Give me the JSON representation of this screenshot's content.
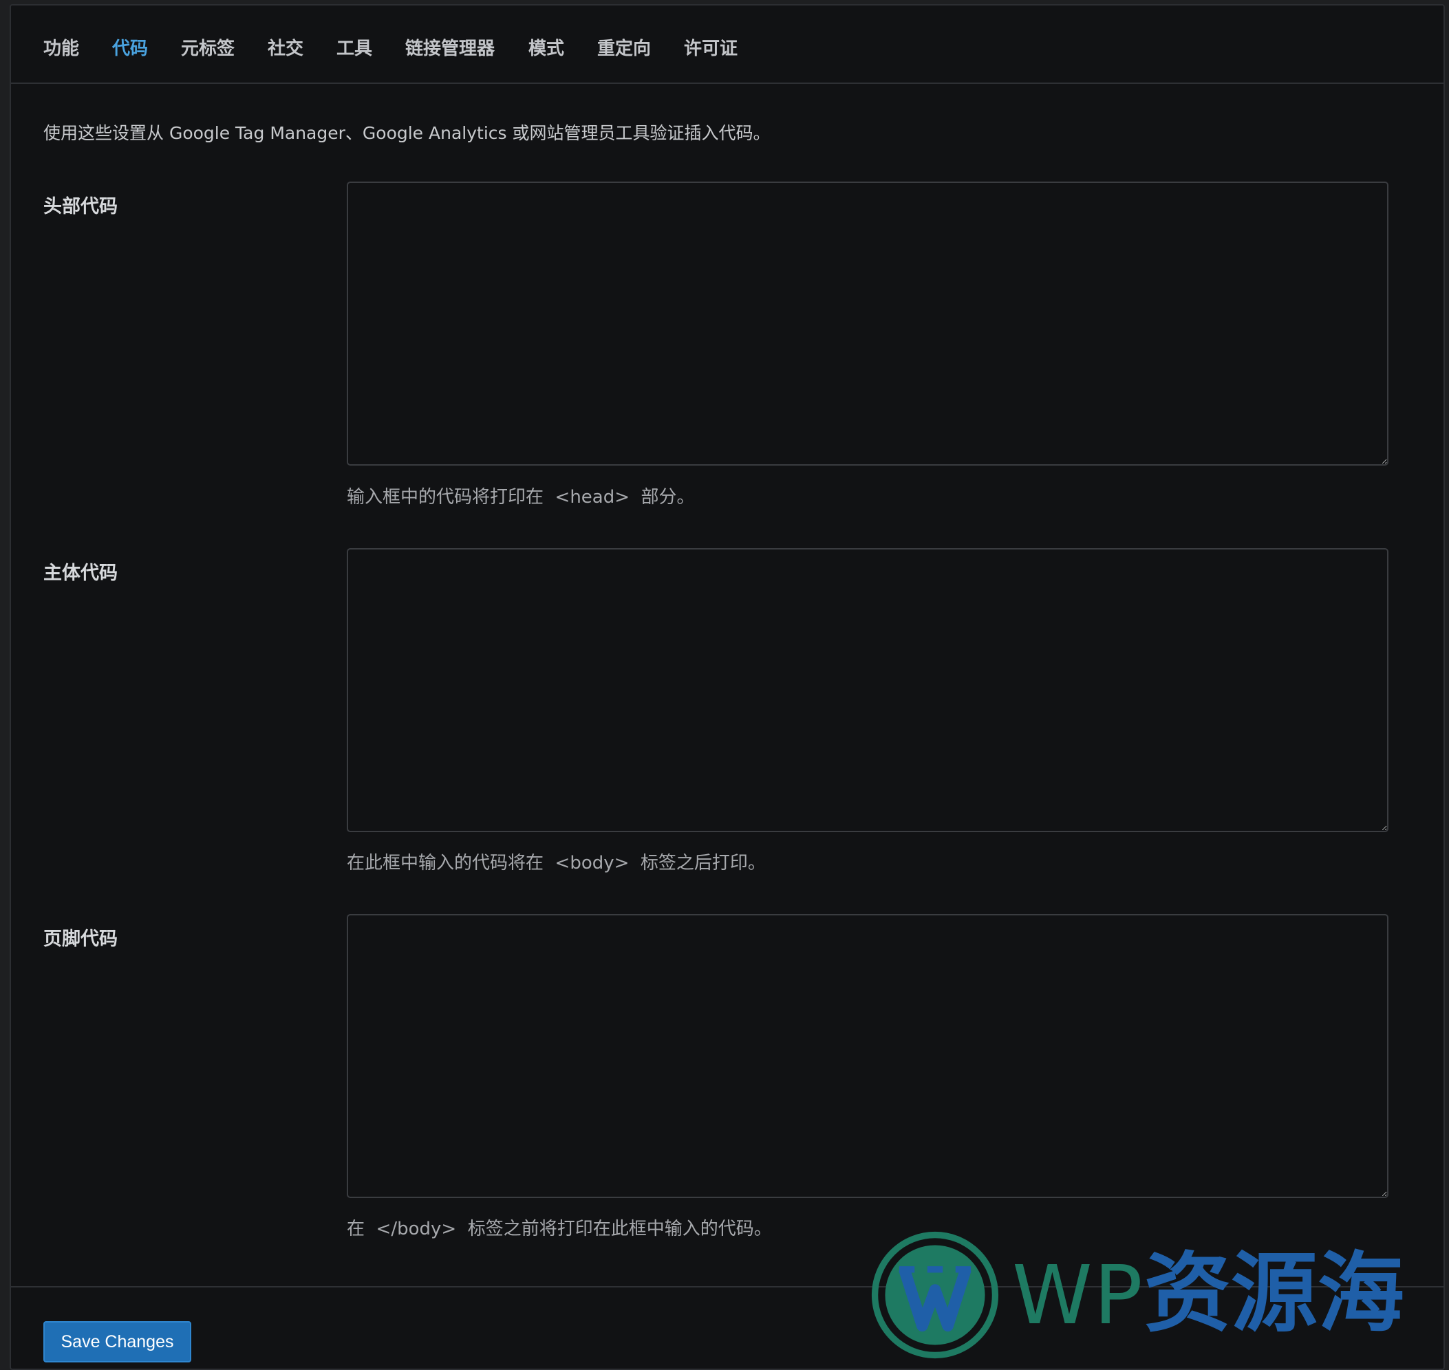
{
  "tabs": [
    {
      "label": "功能"
    },
    {
      "label": "代码"
    },
    {
      "label": "元标签"
    },
    {
      "label": "社交"
    },
    {
      "label": "工具"
    },
    {
      "label": "链接管理器"
    },
    {
      "label": "模式"
    },
    {
      "label": "重定向"
    },
    {
      "label": "许可证"
    }
  ],
  "active_tab": "代码",
  "intro": "使用这些设置从 Google Tag Manager、Google Analytics 或网站管理员工具验证插入代码。",
  "fields": [
    {
      "label": "头部代码",
      "value": "",
      "description": "输入框中的代码将打印在  <head>  部分。"
    },
    {
      "label": "主体代码",
      "value": "",
      "description": "在此框中输入的代码将在  <body>  标签之后打印。"
    },
    {
      "label": "页脚代码",
      "value": "",
      "description": "在  </body>  标签之前将打印在此框中输入的代码。"
    }
  ],
  "save_button": {
    "label": "Save Changes"
  },
  "watermark": {
    "text_latin": "WP",
    "text_cn": "资源海"
  },
  "colors": {
    "background": "#111214",
    "accent": "#4aa3e0",
    "button": "#1f6fb5",
    "watermark_green": "#1e7a62",
    "watermark_blue": "#1f5fa8"
  }
}
